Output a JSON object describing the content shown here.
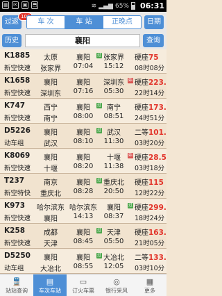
{
  "status_bar": {
    "battery": "65%",
    "time": "06:31"
  },
  "header": {
    "back_label": "过返",
    "badge_count": "106",
    "tabs": [
      "车 次",
      "车 站",
      "正晚点"
    ],
    "active_tab": 1,
    "date_label": "日期"
  },
  "search": {
    "history_label": "历史",
    "station_value": "襄阳",
    "query_label": "查询"
  },
  "trains": [
    {
      "number": "K1885",
      "type": "新空快速",
      "from": "太原",
      "to": "张家界",
      "depart_station": "襄阳",
      "depart_time": "07:04",
      "arrive_station": "张家界",
      "arrive_time": "15:12",
      "seat": "硬座",
      "price": "75",
      "duration": "08时08分",
      "mark1": "过",
      "mark2": ""
    },
    {
      "number": "K1658",
      "type": "新空快速",
      "from": "襄阳",
      "to": "深圳东",
      "depart_station": "襄阳",
      "depart_time": "07:16",
      "arrive_station": "深圳东",
      "arrive_time": "05:30",
      "seat": "硬座",
      "price": "223.5",
      "duration": "22时14分",
      "mark1": "",
      "mark2": "始"
    },
    {
      "number": "K747",
      "type": "新空快速",
      "from": "西宁",
      "to": "南宁",
      "depart_station": "襄阳",
      "depart_time": "08:00",
      "arrive_station": "南宁",
      "arrive_time": "08:51",
      "seat": "硬座",
      "price": "173.5",
      "duration": "24时51分",
      "mark1": "过",
      "mark2": ""
    },
    {
      "number": "D5226",
      "type": "动车组",
      "from": "襄阳",
      "to": "武汉",
      "depart_station": "襄阳",
      "depart_time": "08:10",
      "arrive_station": "武汉",
      "arrive_time": "11:30",
      "seat": "二等",
      "price": "101.5",
      "duration": "03时20分",
      "mark1": "过",
      "mark2": ""
    },
    {
      "number": "K8069",
      "type": "新空快速",
      "from": "襄阳",
      "to": "十堰",
      "depart_station": "襄阳",
      "depart_time": "08:20",
      "arrive_station": "十堰",
      "arrive_time": "11:38",
      "seat": "硬座",
      "price": "28.5",
      "duration": "03时18分",
      "mark1": "",
      "mark2": "始"
    },
    {
      "number": "T237",
      "type": "新空特快",
      "from": "南京",
      "to": "重庆北",
      "depart_station": "襄阳",
      "depart_time": "08:28",
      "arrive_station": "重庆北",
      "arrive_time": "20:50",
      "seat": "硬座",
      "price": "115",
      "duration": "12时22分",
      "mark1": "过",
      "mark2": ""
    },
    {
      "number": "K973",
      "type": "新空快速",
      "from": "哈尔滨东",
      "to": "襄阳",
      "depart_station": "哈尔滨东",
      "depart_time": "14:13",
      "arrive_station": "襄阳",
      "arrive_time": "08:37",
      "seat": "硬座",
      "price": "299.5",
      "duration": "18时24分",
      "mark1": "",
      "mark2": "过"
    },
    {
      "number": "K258",
      "type": "新空快速",
      "from": "成都",
      "to": "天津",
      "depart_station": "襄阳",
      "depart_time": "08:45",
      "arrive_station": "天津",
      "arrive_time": "05:50",
      "seat": "硬座",
      "price": "163.5",
      "duration": "21时05分",
      "mark1": "过",
      "mark2": ""
    },
    {
      "number": "D5250",
      "type": "动车组",
      "from": "襄阳",
      "to": "大冶北",
      "depart_station": "襄阳",
      "depart_time": "08:55",
      "arrive_station": "大冶北",
      "arrive_time": "12:05",
      "seat": "二等",
      "price": "133.5",
      "duration": "03时10分",
      "mark1": "过",
      "mark2": ""
    }
  ],
  "tabbar": {
    "items": [
      {
        "label": "站站查询",
        "icon": "train-icon"
      },
      {
        "label": "车次车站",
        "icon": "station-icon"
      },
      {
        "label": "订火车票",
        "icon": "ticket-icon"
      },
      {
        "label": "银行采风",
        "icon": "bank-icon"
      },
      {
        "label": "更多",
        "icon": "more-icon"
      }
    ],
    "active": 1
  }
}
